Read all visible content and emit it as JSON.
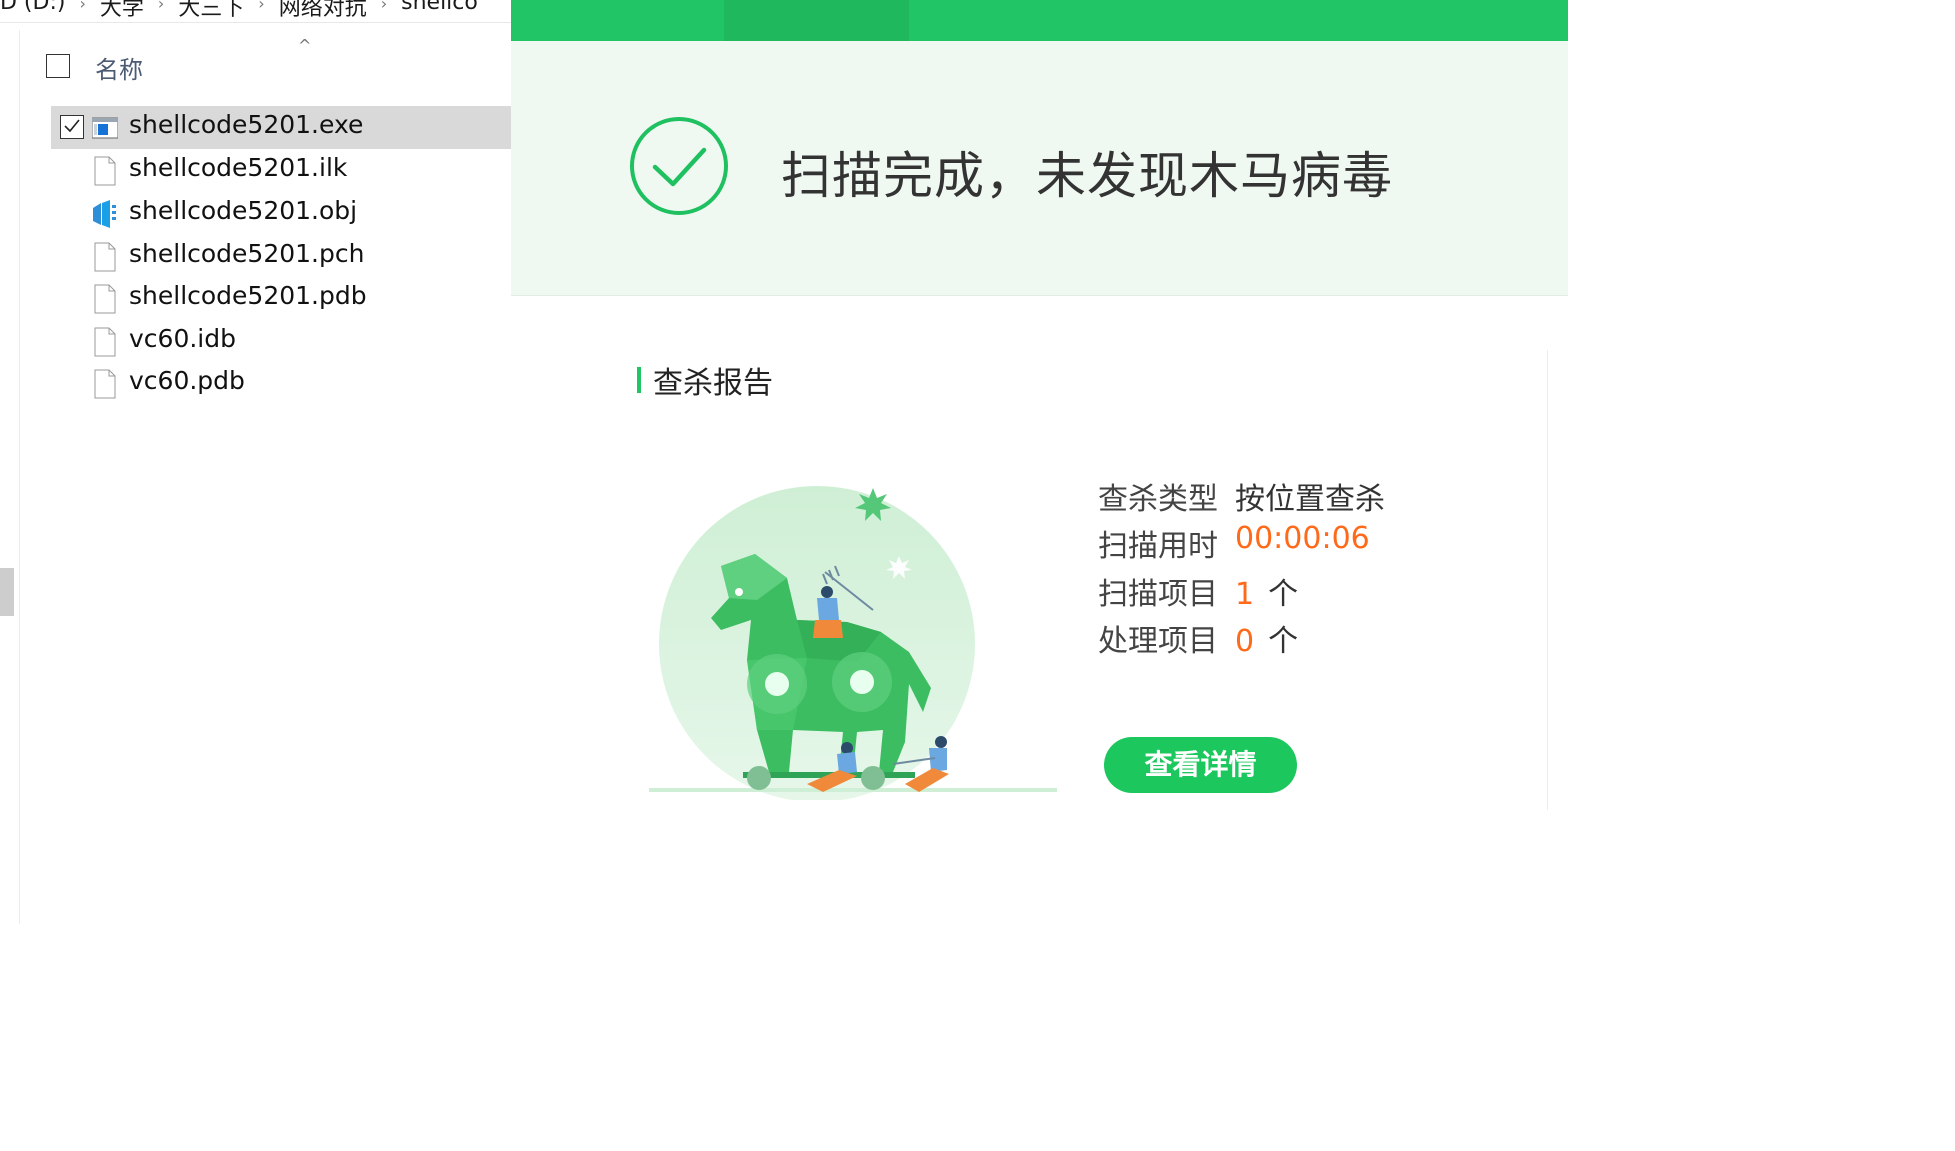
{
  "explorer": {
    "breadcrumb": [
      "D (D:)",
      "大学",
      "大三下",
      "网络对抗",
      "shellco"
    ],
    "column_name": "名称",
    "files": [
      {
        "name": "shellcode5201.exe",
        "icon": "exe-file-icon",
        "selected": true
      },
      {
        "name": "shellcode5201.ilk",
        "icon": "blank-file-icon",
        "selected": false
      },
      {
        "name": "shellcode5201.obj",
        "icon": "visual-studio-obj-icon",
        "selected": false
      },
      {
        "name": "shellcode5201.pch",
        "icon": "blank-file-icon",
        "selected": false
      },
      {
        "name": "shellcode5201.pdb",
        "icon": "blank-file-icon",
        "selected": false
      },
      {
        "name": "vc60.idb",
        "icon": "blank-file-icon",
        "selected": false
      },
      {
        "name": "vc60.pdb",
        "icon": "blank-file-icon",
        "selected": false
      }
    ]
  },
  "scanner": {
    "result_title": "扫描完成，未发现木马病毒",
    "report_title": "查杀报告",
    "stats": [
      {
        "label": "查杀类型",
        "value": "按位置查杀",
        "unit": "",
        "accent": false
      },
      {
        "label": "扫描用时",
        "value": "00:00:06",
        "unit": "",
        "accent": true
      },
      {
        "label": "扫描项目",
        "value": "1",
        "unit": "个",
        "accent": true
      },
      {
        "label": "处理项目",
        "value": "0",
        "unit": "个",
        "accent": true
      }
    ],
    "detail_button": "查看详情"
  },
  "colors": {
    "brand_green": "#22c565",
    "accent_orange": "#ff6a1a",
    "banner_bg": "#f0f8f2",
    "selection_bg": "#d9d9d9"
  }
}
